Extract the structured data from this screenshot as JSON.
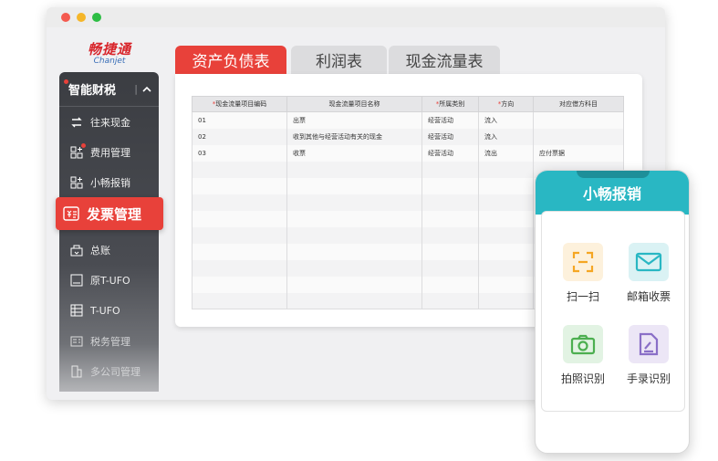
{
  "brand": {
    "name_cn": "畅捷通",
    "name_en": "Chanjet"
  },
  "sidebar": {
    "header": "智能财税",
    "items": [
      {
        "label": "往来现金"
      },
      {
        "label": "费用管理"
      },
      {
        "label": "小畅报销"
      },
      {
        "label": "发票管理"
      },
      {
        "label": "总账"
      },
      {
        "label": "原T-UFO"
      },
      {
        "label": "T-UFO"
      },
      {
        "label": "税务管理"
      },
      {
        "label": "多公司管理"
      }
    ]
  },
  "tabs": [
    {
      "label": "资产负债表",
      "active": true
    },
    {
      "label": "利润表",
      "active": false
    },
    {
      "label": "现金流量表",
      "active": false
    }
  ],
  "table": {
    "headers": [
      {
        "label": "现金流量项目编码",
        "required": true
      },
      {
        "label": "现金流量项目名称",
        "required": false
      },
      {
        "label": "所属类别",
        "required": true
      },
      {
        "label": "方向",
        "required": true
      },
      {
        "label": "对应借方科目",
        "required": false
      }
    ],
    "rows": [
      [
        "01",
        "出票",
        "经营活动",
        "流入",
        ""
      ],
      [
        "02",
        "收到其他与经营活动有关的现金",
        "经营活动",
        "流入",
        ""
      ],
      [
        "03",
        "收票",
        "经营活动",
        "流出",
        "应付票据"
      ]
    ],
    "empty_rows": 9
  },
  "mobile": {
    "title": "小畅报销",
    "actions": [
      {
        "label": "扫一扫",
        "icon": "scan-icon",
        "color": "#f5a623"
      },
      {
        "label": "邮箱收票",
        "icon": "mail-icon",
        "color": "#29b7c3"
      },
      {
        "label": "拍照识别",
        "icon": "camera-icon",
        "color": "#4caf50"
      },
      {
        "label": "手录识别",
        "icon": "manual-entry-icon",
        "color": "#8a6fc7"
      }
    ]
  },
  "colors": {
    "accent": "#e8413a",
    "mobile_header": "#29b7c3",
    "sidebar_bg": "#3b3d42"
  }
}
